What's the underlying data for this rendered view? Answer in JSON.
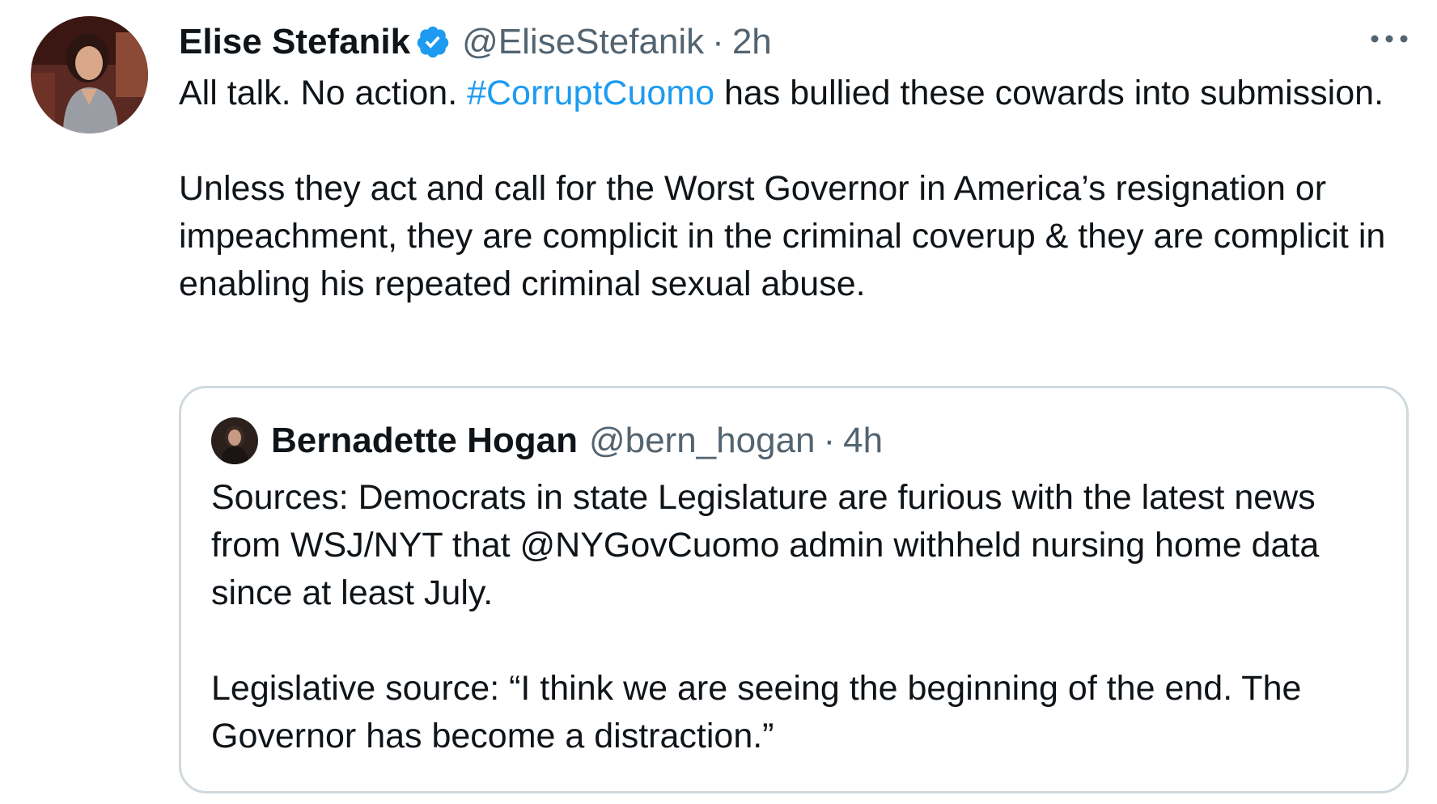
{
  "tweet": {
    "author": {
      "display_name": "Elise Stefanik",
      "handle": "@EliseStefanik",
      "verified": true,
      "avatar_icon": "profile-photo"
    },
    "separator": "·",
    "time": "2h",
    "more_icon": "more-horizontal-icon",
    "text": {
      "line1_before": "All talk. No action. ",
      "hashtag": "#CorruptCuomo",
      "line1_after": " has bullied these cowards into submission.",
      "paragraph2": "Unless they act and call for the Worst Governor in America’s resignation or impeachment, they are complicit in the criminal coverup & they are complicit in enabling his repeated criminal sexual abuse."
    }
  },
  "quoted_tweet": {
    "author": {
      "display_name": "Bernadette Hogan",
      "handle": "@bern_hogan",
      "avatar_icon": "profile-photo"
    },
    "separator": "·",
    "time": "4h",
    "paragraph1": "Sources: Democrats in state Legislature are furious with the latest news from WSJ/NYT that @NYGovCuomo admin withheld nursing home data since at least July.",
    "paragraph2": "Legislative source: “I think we are seeing the beginning of the end. The Governor has become a distraction.”"
  },
  "colors": {
    "text": "#0f1419",
    "secondary": "#536471",
    "link": "#1d9bf0",
    "verified": "#1d9bf0",
    "border": "#cfd9de"
  }
}
